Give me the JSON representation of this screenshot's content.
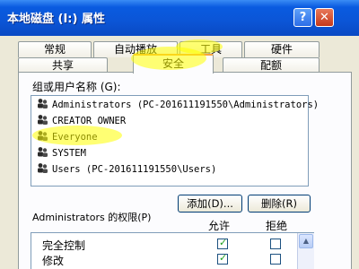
{
  "window": {
    "title": "本地磁盘 (I:) 属性",
    "help_button": "?",
    "close_button": "✕"
  },
  "tabs_row1": [
    "常规",
    "自动播放",
    "工具",
    "硬件"
  ],
  "tabs_row2": [
    "共享",
    "安全",
    "配额"
  ],
  "active_tab": "安全",
  "group_users": {
    "label": "组或用户名称 (G):",
    "items": [
      "Administrators (PC-201611191550\\Administrators)",
      "CREATOR OWNER",
      "Everyone",
      "SYSTEM",
      "Users (PC-201611191550\\Users)"
    ]
  },
  "buttons": {
    "add": "添加(D)...",
    "remove": "删除(R)"
  },
  "permissions": {
    "label": "Administrators 的权限(P)",
    "allow_header": "允许",
    "deny_header": "拒绝",
    "rows": [
      {
        "name": "完全控制",
        "allow": true,
        "deny": false
      },
      {
        "name": "修改",
        "allow": true,
        "deny": false
      }
    ]
  },
  "colors": {
    "titlebar": "#0b55d6",
    "highlight": "#ffff00"
  }
}
